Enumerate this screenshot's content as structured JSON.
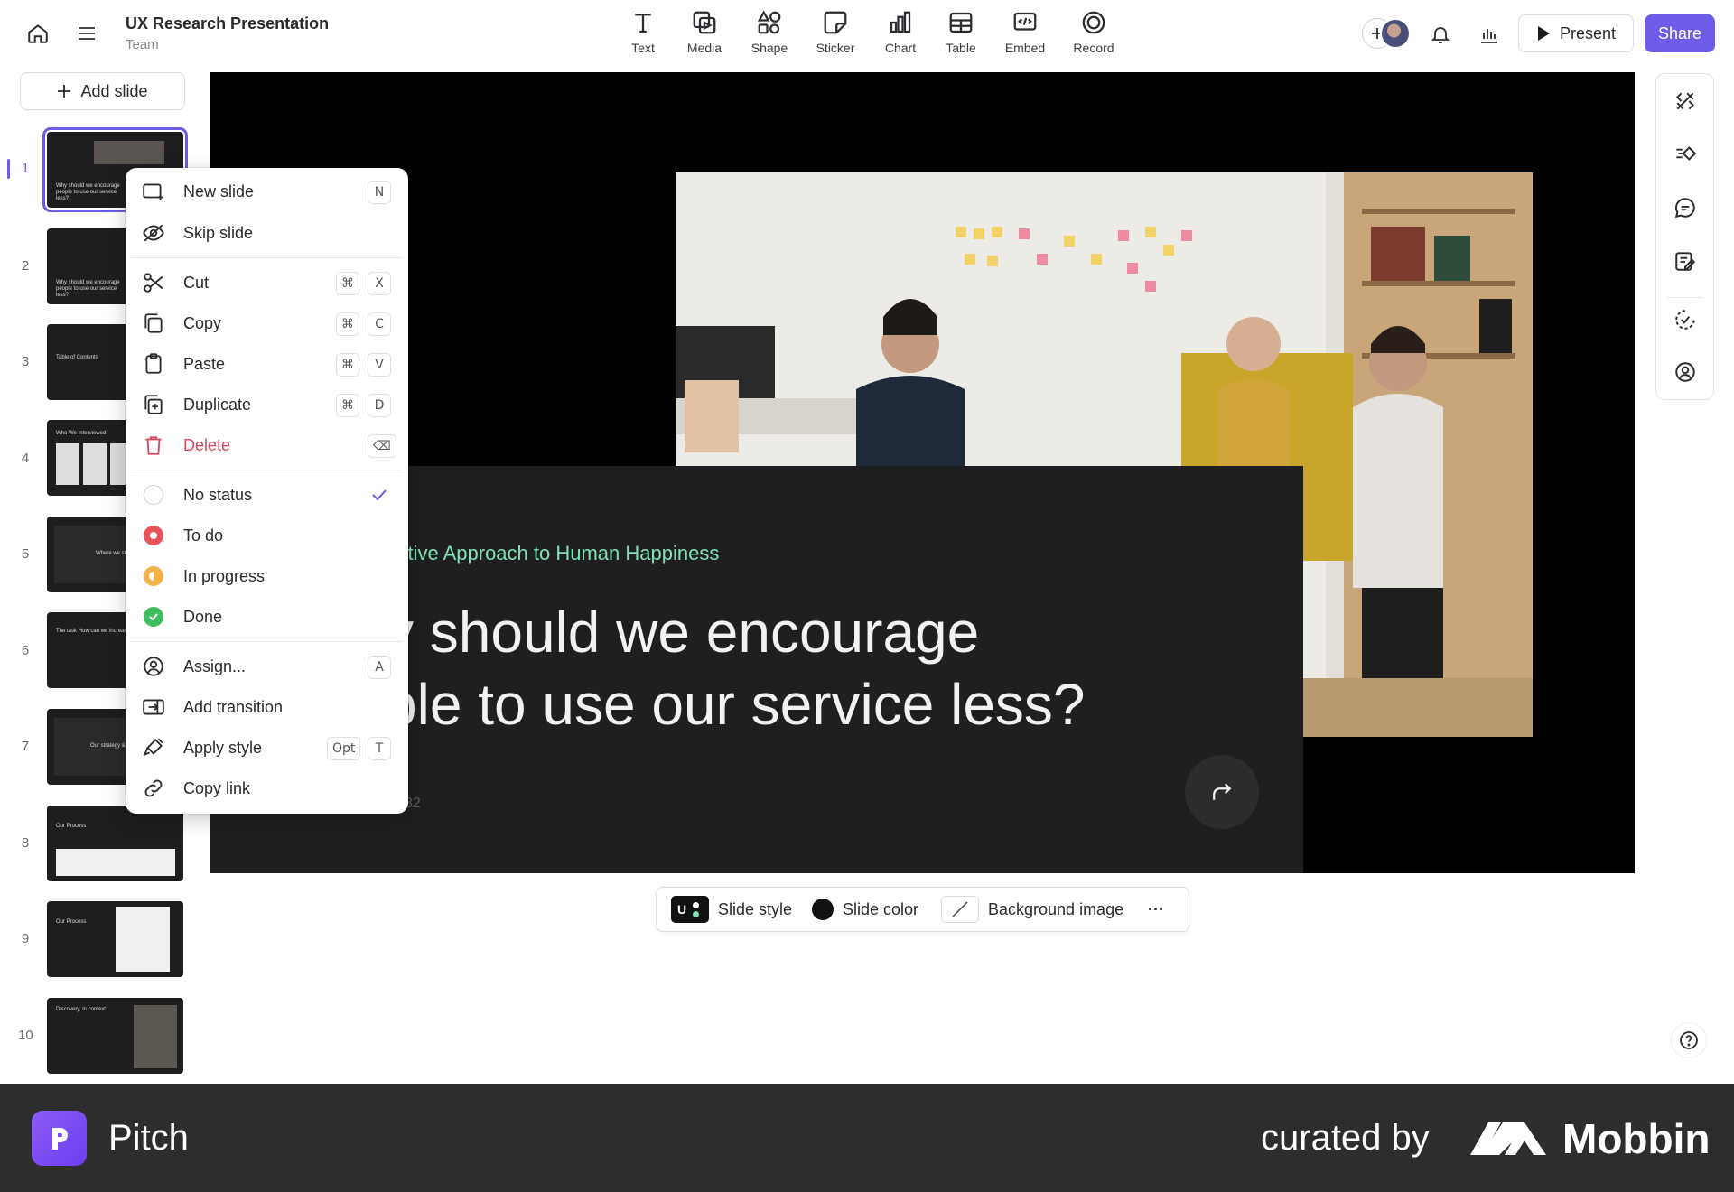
{
  "header": {
    "title": "UX Research Presentation",
    "subtitle": "Team",
    "tools": [
      {
        "label": "Text",
        "icon": "text-icon"
      },
      {
        "label": "Media",
        "icon": "media-icon"
      },
      {
        "label": "Shape",
        "icon": "shape-icon"
      },
      {
        "label": "Sticker",
        "icon": "sticker-icon"
      },
      {
        "label": "Chart",
        "icon": "chart-icon"
      },
      {
        "label": "Table",
        "icon": "table-icon"
      },
      {
        "label": "Embed",
        "icon": "embed-icon"
      },
      {
        "label": "Record",
        "icon": "record-icon"
      }
    ],
    "present_label": "Present",
    "share_label": "Share"
  },
  "sidebar": {
    "add_slide_label": "Add slide",
    "slides": [
      {
        "number": "1",
        "text": "Why should we encourage people to use our service less?"
      },
      {
        "number": "2",
        "text": "Why should we encourage people to use our service less?"
      },
      {
        "number": "3",
        "text": "Table of Contents"
      },
      {
        "number": "4",
        "text": "Who We Interviewed"
      },
      {
        "number": "5",
        "text": "Where we started"
      },
      {
        "number": "6",
        "text": "The task    How can we increase"
      },
      {
        "number": "7",
        "text": "Our strategy & approach"
      },
      {
        "number": "8",
        "text": "Our Process"
      },
      {
        "number": "9",
        "text": "Our Process"
      },
      {
        "number": "10",
        "text": "Discovery, in context"
      }
    ]
  },
  "slide": {
    "eyebrow": "ntuitive Approach to Human Happiness",
    "headline_line1": "y should we encourage",
    "headline_line2": "ple to use our service less?",
    "page_stub": "32"
  },
  "slide_toolbar": {
    "style_badge": "U",
    "style_label": "Slide style",
    "color_label": "Slide color",
    "background_label": "Background image",
    "more_label": "···"
  },
  "context_menu": {
    "items": [
      {
        "label": "New slide",
        "shortcut": [
          "N"
        ]
      },
      {
        "label": "Skip slide",
        "shortcut": []
      },
      {
        "label": "Cut",
        "shortcut": [
          "⌘",
          "X"
        ]
      },
      {
        "label": "Copy",
        "shortcut": [
          "⌘",
          "C"
        ]
      },
      {
        "label": "Paste",
        "shortcut": [
          "⌘",
          "V"
        ]
      },
      {
        "label": "Duplicate",
        "shortcut": [
          "⌘",
          "D"
        ]
      },
      {
        "label": "Delete",
        "shortcut": [
          "⌫"
        ]
      },
      {
        "label": "No status",
        "selected": true
      },
      {
        "label": "To do"
      },
      {
        "label": "In progress"
      },
      {
        "label": "Done"
      },
      {
        "label": "Assign...",
        "shortcut": [
          "A"
        ]
      },
      {
        "label": "Add transition",
        "shortcut": []
      },
      {
        "label": "Apply style",
        "shortcut": [
          "Opt",
          "T"
        ]
      },
      {
        "label": "Copy link",
        "shortcut": []
      }
    ]
  },
  "colors": {
    "accent": "#6c5ce7",
    "danger": "#d9485f",
    "status_todo": "#e8525a",
    "status_progress": "#f2b24a",
    "status_done": "#3dbd5d",
    "eyebrow": "#7fe3b5"
  },
  "footer": {
    "brand": "Pitch",
    "curated_by": "curated by",
    "curator": "Mobbin"
  }
}
